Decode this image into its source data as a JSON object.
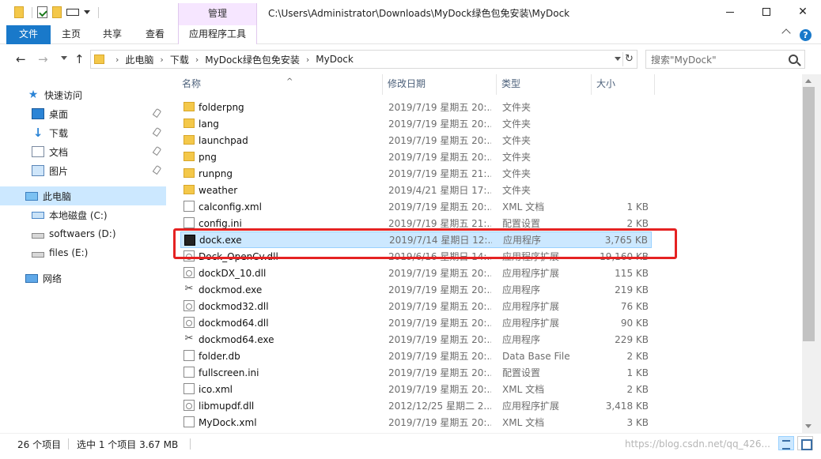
{
  "window": {
    "title": "C:\\Users\\Administrator\\Downloads\\MyDock绿色包免安装\\MyDock",
    "context_tab": "管理",
    "controls": {
      "minimize": "—",
      "maximize": "",
      "close": "✕"
    }
  },
  "ribbon": {
    "tabs": [
      "文件",
      "主页",
      "共享",
      "查看",
      "应用程序工具"
    ]
  },
  "address": {
    "crumbs": [
      "此电脑",
      "下载",
      "MyDock绿色包免安装",
      "MyDock"
    ],
    "separator": "›",
    "refresh": "↻"
  },
  "search": {
    "placeholder": "搜索\"MyDock\""
  },
  "nav": {
    "back": "←",
    "forward": "→",
    "up": "↑"
  },
  "sidebar": {
    "items": [
      {
        "label": "快速访问",
        "icon": "star-icon",
        "pinned": false
      },
      {
        "label": "桌面",
        "icon": "desktop-icon",
        "pinned": true
      },
      {
        "label": "下载",
        "icon": "download-icon",
        "pinned": true
      },
      {
        "label": "文档",
        "icon": "document-icon",
        "pinned": true
      },
      {
        "label": "图片",
        "icon": "picture-icon",
        "pinned": true
      },
      {
        "label": "此电脑",
        "icon": "computer-icon",
        "selected": true
      },
      {
        "label": "本地磁盘 (C:)",
        "icon": "drive-icon"
      },
      {
        "label": "softwaers (D:)",
        "icon": "drive-icon"
      },
      {
        "label": "files (E:)",
        "icon": "drive-icon"
      },
      {
        "label": "网络",
        "icon": "network-icon"
      }
    ]
  },
  "columns": [
    "名称",
    "修改日期",
    "类型",
    "大小"
  ],
  "sort_indicator": "^",
  "files": [
    {
      "name": "folderpng",
      "date": "2019/7/19 星期五 20:...",
      "type": "文件夹",
      "size": "",
      "icon": "folder"
    },
    {
      "name": "lang",
      "date": "2019/7/19 星期五 20:...",
      "type": "文件夹",
      "size": "",
      "icon": "folder"
    },
    {
      "name": "launchpad",
      "date": "2019/7/19 星期五 20:...",
      "type": "文件夹",
      "size": "",
      "icon": "folder"
    },
    {
      "name": "png",
      "date": "2019/7/19 星期五 20:...",
      "type": "文件夹",
      "size": "",
      "icon": "folder"
    },
    {
      "name": "runpng",
      "date": "2019/7/19 星期五 21:...",
      "type": "文件夹",
      "size": "",
      "icon": "folder"
    },
    {
      "name": "weather",
      "date": "2019/4/21 星期日 17:...",
      "type": "文件夹",
      "size": "",
      "icon": "folder"
    },
    {
      "name": "calconfig.xml",
      "date": "2019/7/19 星期五 20:...",
      "type": "XML 文档",
      "size": "1 KB",
      "icon": "xml"
    },
    {
      "name": "config.ini",
      "date": "2019/7/19 星期五 21:...",
      "type": "配置设置",
      "size": "2 KB",
      "icon": "ini"
    },
    {
      "name": "dock.exe",
      "date": "2019/7/14 星期日 12:...",
      "type": "应用程序",
      "size": "3,765 KB",
      "icon": "exe",
      "selected": true
    },
    {
      "name": "Dock_OpenCv.dll",
      "date": "2019/6/16 星期日 14:...",
      "type": "应用程序扩展",
      "size": "19,160 KB",
      "icon": "dll"
    },
    {
      "name": "dockDX_10.dll",
      "date": "2019/7/19 星期五 20:...",
      "type": "应用程序扩展",
      "size": "115 KB",
      "icon": "dll"
    },
    {
      "name": "dockmod.exe",
      "date": "2019/7/19 星期五 20:...",
      "type": "应用程序",
      "size": "219 KB",
      "icon": "tools"
    },
    {
      "name": "dockmod32.dll",
      "date": "2019/7/19 星期五 20:...",
      "type": "应用程序扩展",
      "size": "76 KB",
      "icon": "dll"
    },
    {
      "name": "dockmod64.dll",
      "date": "2019/7/19 星期五 20:...",
      "type": "应用程序扩展",
      "size": "90 KB",
      "icon": "dll"
    },
    {
      "name": "dockmod64.exe",
      "date": "2019/7/19 星期五 20:...",
      "type": "应用程序",
      "size": "229 KB",
      "icon": "tools"
    },
    {
      "name": "folder.db",
      "date": "2019/7/19 星期五 20:...",
      "type": "Data Base File",
      "size": "2 KB",
      "icon": "db"
    },
    {
      "name": "fullscreen.ini",
      "date": "2019/7/19 星期五 20:...",
      "type": "配置设置",
      "size": "1 KB",
      "icon": "ini"
    },
    {
      "name": "ico.xml",
      "date": "2019/7/19 星期五 20:...",
      "type": "XML 文档",
      "size": "2 KB",
      "icon": "xml"
    },
    {
      "name": "libmupdf.dll",
      "date": "2012/12/25 星期二 2...",
      "type": "应用程序扩展",
      "size": "3,418 KB",
      "icon": "dll"
    },
    {
      "name": "MyDock.xml",
      "date": "2019/7/19 星期五 20:...",
      "type": "XML 文档",
      "size": "3 KB",
      "icon": "xml"
    }
  ],
  "status": {
    "count": "26 个项目",
    "selection": "选中 1 个项目  3.67 MB"
  },
  "watermark": "https://blog.csdn.net/qq_426...",
  "colors": {
    "accent": "#1979ca",
    "selection": "#cce8ff",
    "highlight_box": "#e52222",
    "context_tab": "#f6e6ff"
  }
}
